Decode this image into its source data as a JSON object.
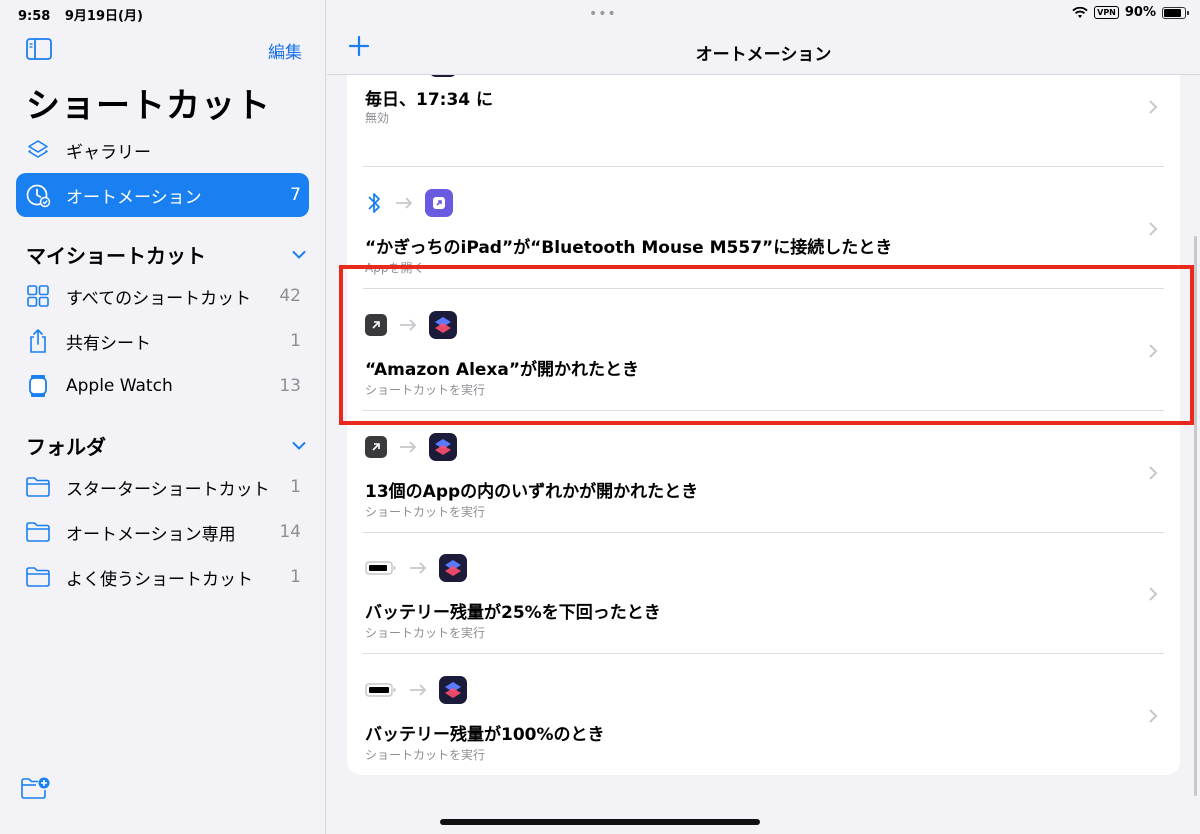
{
  "status": {
    "time": "9:58",
    "date": "9月19日(月)",
    "vpn": "VPN",
    "battery": "90%"
  },
  "sidebar": {
    "edit_label": "編集",
    "title": "ショートカット",
    "nav": [
      {
        "label": "ギャラリー",
        "count": ""
      },
      {
        "label": "オートメーション",
        "count": "7"
      }
    ],
    "my_shortcuts_header": "マイショートカット",
    "my_shortcuts": [
      {
        "label": "すべてのショートカット",
        "count": "42"
      },
      {
        "label": "共有シート",
        "count": "1"
      },
      {
        "label": "Apple Watch",
        "count": "13"
      }
    ],
    "folders_header": "フォルダ",
    "folders": [
      {
        "label": "スターターショートカット",
        "count": "1"
      },
      {
        "label": "オートメーション専用",
        "count": "14"
      },
      {
        "label": "よく使うショートカット",
        "count": "1"
      }
    ]
  },
  "main": {
    "title": "オートメーション",
    "rows": [
      {
        "title": "毎日、17:34 に",
        "subtitle": "無効"
      },
      {
        "title": "“かぎっちのiPad”が“Bluetooth Mouse M557”に接続したとき",
        "subtitle": "Appを開く"
      },
      {
        "title": "“Amazon Alexa”が開かれたとき",
        "subtitle": "ショートカットを実行"
      },
      {
        "title": "13個のAppの内のいずれかが開かれたとき",
        "subtitle": "ショートカットを実行"
      },
      {
        "title": "バッテリー残量が25%を下回ったとき",
        "subtitle": "ショートカットを実行"
      },
      {
        "title": "バッテリー残量が100%のとき",
        "subtitle": "ショートカットを実行"
      }
    ]
  },
  "colors": {
    "accent": "#1a7ff0",
    "highlight": "#e8291c"
  }
}
